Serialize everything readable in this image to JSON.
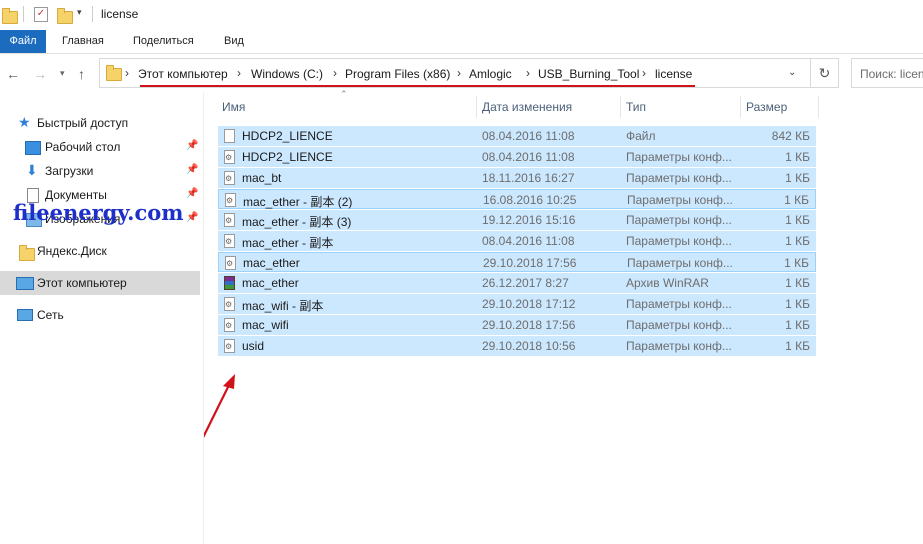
{
  "window": {
    "title": "license"
  },
  "ribbon": {
    "tabs": [
      "Файл",
      "Главная",
      "Поделиться",
      "Вид"
    ]
  },
  "address": {
    "crumbs": [
      "Этот компьютер",
      "Windows (C:)",
      "Program Files (x86)",
      "Amlogic",
      "USB_Burning_Tool",
      "license"
    ]
  },
  "search": {
    "placeholder": "Поиск: licen"
  },
  "sidebar": {
    "items": [
      {
        "label": "Быстрый доступ"
      },
      {
        "label": "Рабочий стол"
      },
      {
        "label": "Загрузки"
      },
      {
        "label": "Документы"
      },
      {
        "label": "Изображения"
      },
      {
        "label": "Яндекс.Диск"
      },
      {
        "label": "Этот компьютер"
      },
      {
        "label": "Сеть"
      }
    ]
  },
  "columns": {
    "name": "Имя",
    "date": "Дата изменения",
    "type": "Тип",
    "size": "Размер"
  },
  "files": [
    {
      "name": "HDCP2_LIENCE",
      "date": "08.04.2016 11:08",
      "type": "Файл",
      "size": "842 КБ",
      "icon": "blank-file-icon"
    },
    {
      "name": "HDCP2_LIENCE",
      "date": "08.04.2016 11:08",
      "type": "Параметры конф...",
      "size": "1 КБ",
      "icon": "config-file-icon"
    },
    {
      "name": "mac_bt",
      "date": "18.11.2016 16:27",
      "type": "Параметры конф...",
      "size": "1 КБ",
      "icon": "config-file-icon"
    },
    {
      "name": "mac_ether - 副本 (2)",
      "date": "16.08.2016 10:25",
      "type": "Параметры конф...",
      "size": "1 КБ",
      "icon": "config-file-icon"
    },
    {
      "name": "mac_ether - 副本 (3)",
      "date": "19.12.2016 15:16",
      "type": "Параметры конф...",
      "size": "1 КБ",
      "icon": "config-file-icon"
    },
    {
      "name": "mac_ether - 副本",
      "date": "08.04.2016 11:08",
      "type": "Параметры конф...",
      "size": "1 КБ",
      "icon": "config-file-icon"
    },
    {
      "name": "mac_ether",
      "date": "29.10.2018 17:56",
      "type": "Параметры конф...",
      "size": "1 КБ",
      "icon": "config-file-icon"
    },
    {
      "name": "mac_ether",
      "date": "26.12.2017 8:27",
      "type": "Архив WinRAR",
      "size": "1 КБ",
      "icon": "winrar-icon"
    },
    {
      "name": "mac_wifi - 副本",
      "date": "29.10.2018 17:12",
      "type": "Параметры конф...",
      "size": "1 КБ",
      "icon": "config-file-icon"
    },
    {
      "name": "mac_wifi",
      "date": "29.10.2018 17:56",
      "type": "Параметры конф...",
      "size": "1 КБ",
      "icon": "config-file-icon"
    },
    {
      "name": "usid",
      "date": "29.10.2018 10:56",
      "type": "Параметры конф...",
      "size": "1 КБ",
      "icon": "config-file-icon"
    }
  ],
  "watermark": {
    "text": "fileenergy.com"
  },
  "colors": {
    "selection": "#cce8ff",
    "file_tab": "#1b6bbf",
    "annotation": "#d0121b"
  }
}
